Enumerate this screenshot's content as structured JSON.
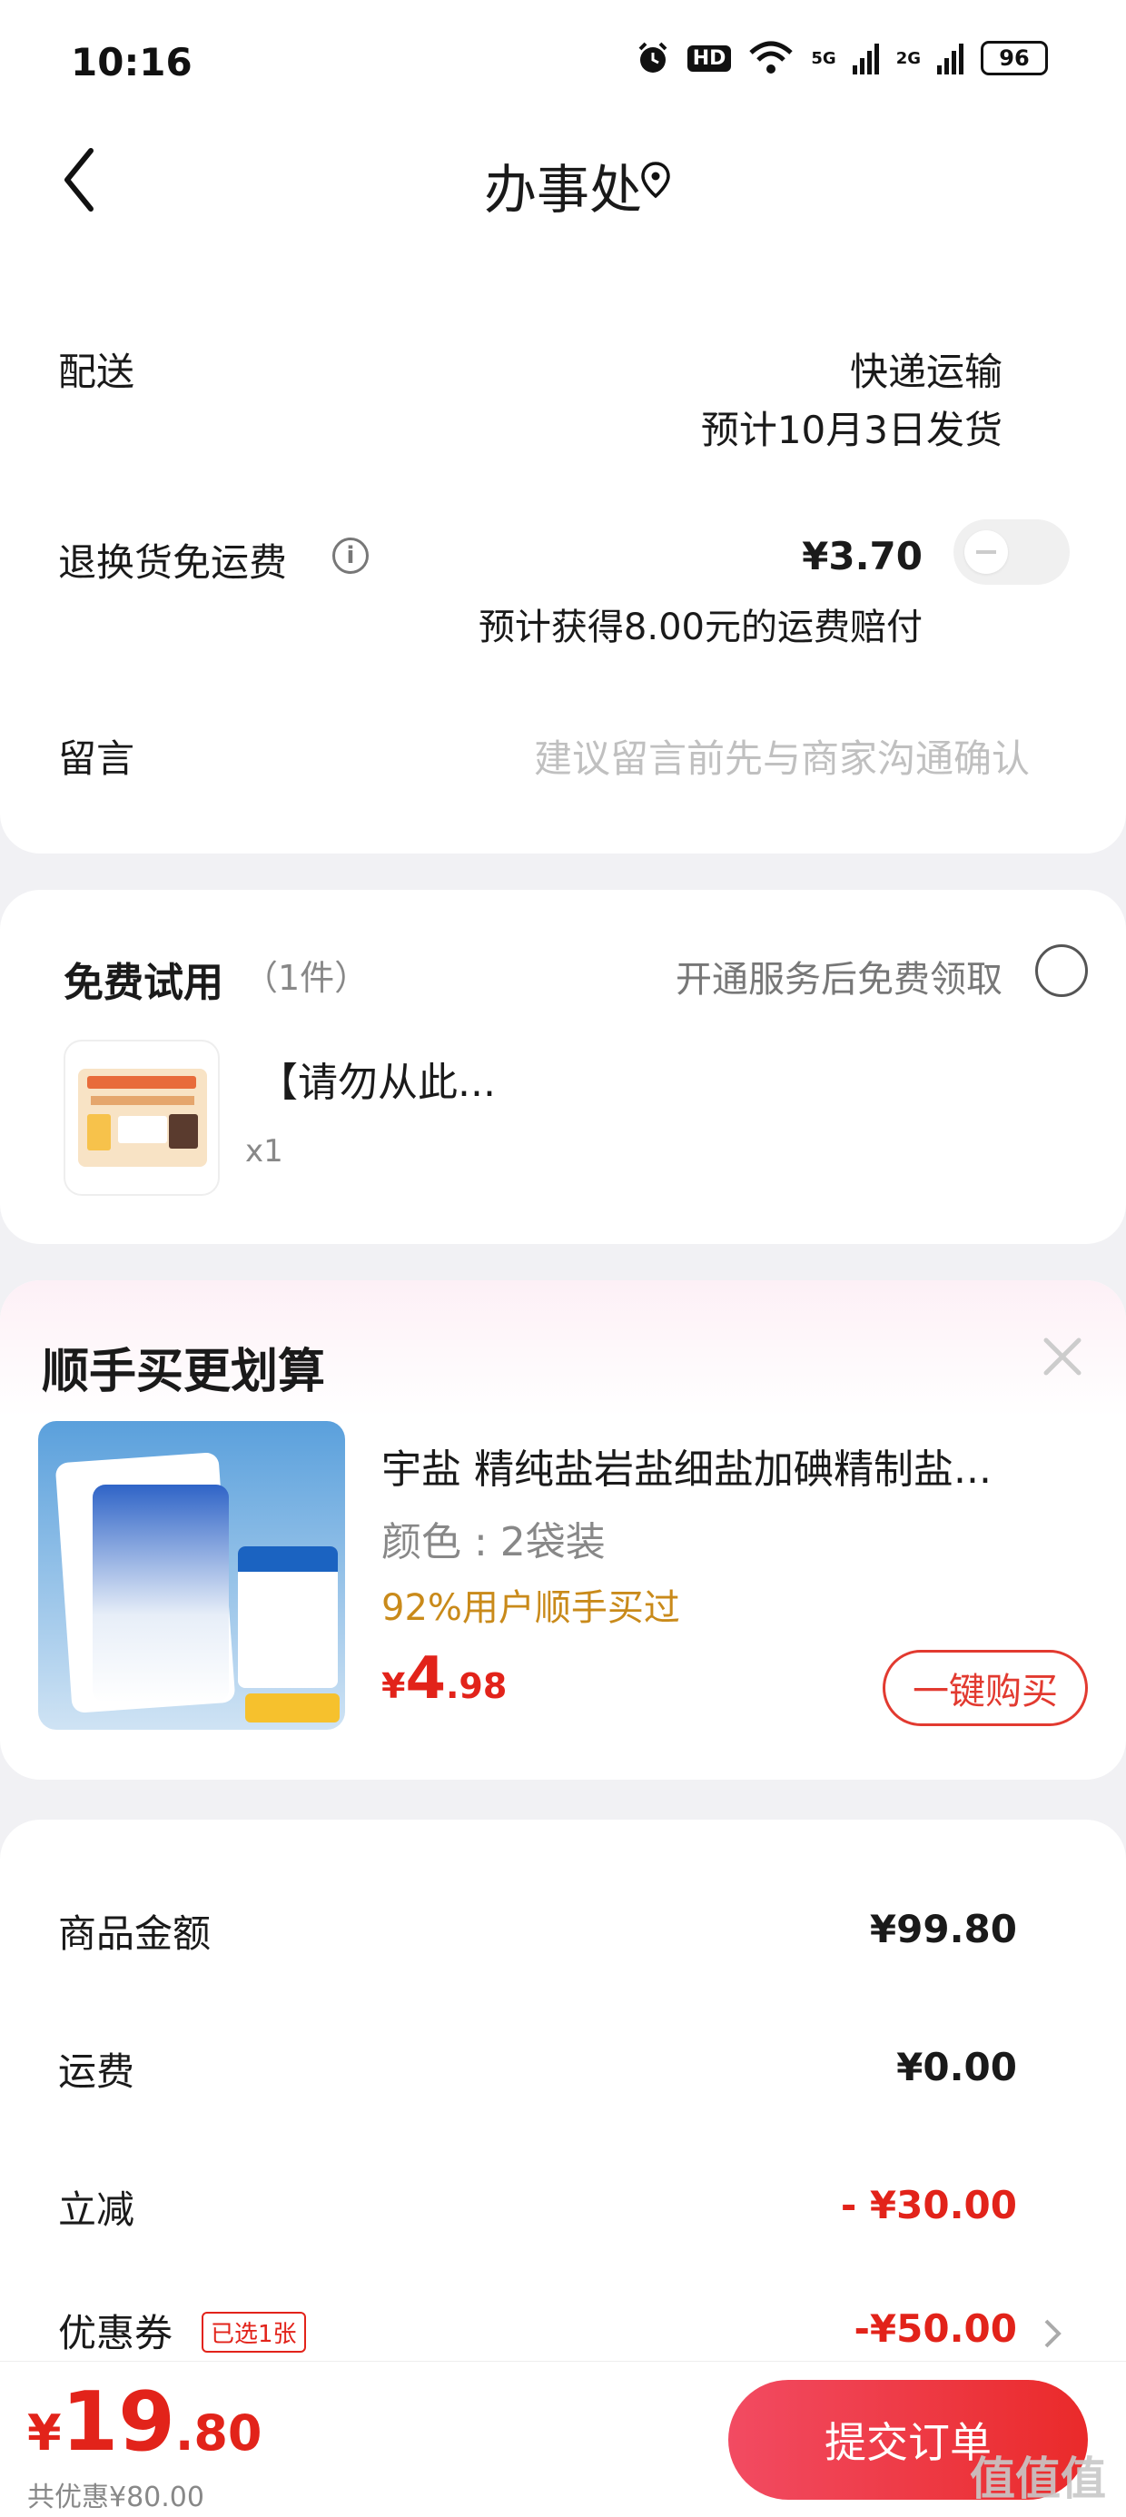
{
  "status_bar": {
    "time": "10:16",
    "network1": "5G",
    "network2": "2G",
    "hd_label": "HD",
    "battery": "96"
  },
  "header": {
    "title": "办事处"
  },
  "delivery": {
    "label": "配送",
    "method": "快递运输",
    "eta": "预计10月3日发货",
    "return_label": "退换货免运费",
    "return_price": "¥3.70",
    "return_note": "预计获得8.00元的运费赔付",
    "message_label": "留言",
    "message_placeholder": "建议留言前先与商家沟通确认"
  },
  "free_trial": {
    "title": "免费试用",
    "count": "（1件）",
    "hint": "开通服务后免费领取",
    "item_name": "【请勿从此...",
    "item_qty": "x1"
  },
  "upsell": {
    "title": "顺手买更划算",
    "product_name": "宇盐 精纯盐岩盐细盐加碘精制盐...",
    "spec": "颜色 : 2袋装",
    "social": "92%用户顺手买过",
    "price_symbol": "¥",
    "price_int": "4",
    "price_dec": ".98",
    "buy_button": "一键购买"
  },
  "summary": {
    "goods_label": "商品金额",
    "goods_value": "¥99.80",
    "shipping_label": "运费",
    "shipping_value": "¥0.00",
    "discount_label": "立减",
    "discount_value": "- ¥30.00",
    "coupon_label": "优惠券",
    "coupon_tag": "已选1张",
    "coupon_value": "-¥50.00"
  },
  "bottom": {
    "price_symbol": "¥",
    "price_int": "19",
    "price_dec": ".80",
    "saved": "共优惠¥80.00",
    "submit_label": "提交订单",
    "watermark": "值值值"
  },
  "colors": {
    "accent": "#e2231a",
    "button_gradient_start": "#f24b62",
    "button_gradient_end": "#ea2a2a",
    "social_proof": "#c98a1a"
  }
}
